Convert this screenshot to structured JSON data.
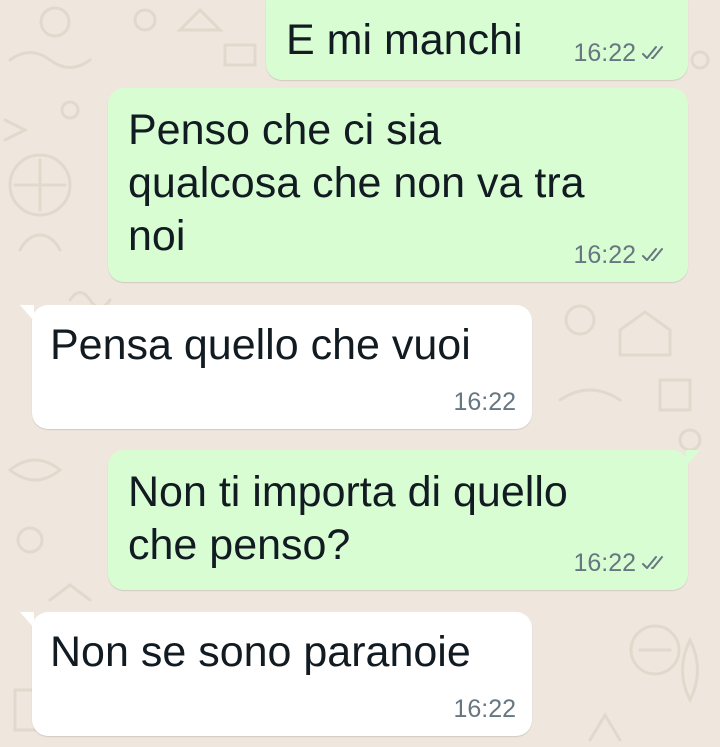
{
  "chat": {
    "messages": [
      {
        "direction": "outgoing",
        "text": "E mi manchi",
        "time": "16:22",
        "status_icon": "double-check-icon"
      },
      {
        "direction": "outgoing",
        "text": "Penso che ci sia\nqualcosa che non va tra\nnoi",
        "time": "16:22",
        "status_icon": "double-check-icon"
      },
      {
        "direction": "incoming",
        "text": "Pensa quello che vuoi",
        "time": "16:22"
      },
      {
        "direction": "outgoing",
        "text": "Non ti importa di quello\nche penso?",
        "time": "16:22",
        "status_icon": "double-check-icon"
      },
      {
        "direction": "incoming",
        "text": "Non se sono paranoie",
        "time": "16:22"
      }
    ]
  },
  "colors": {
    "wallpaper": "#efe7dd",
    "outgoing_bubble": "#d9fdd3",
    "incoming_bubble": "#ffffff",
    "message_text": "#111b21",
    "meta_text": "#667781"
  }
}
